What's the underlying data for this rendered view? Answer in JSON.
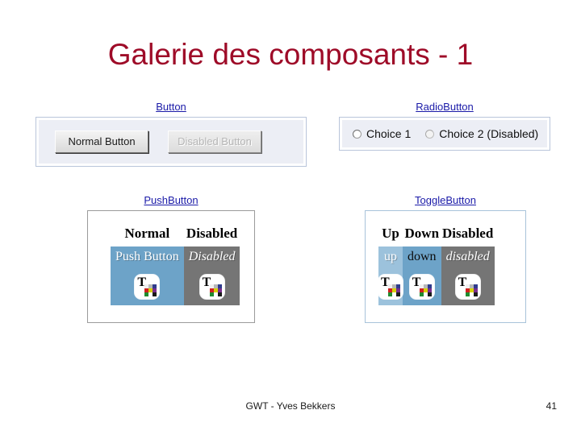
{
  "slide": {
    "title": "Galerie des composants - 1",
    "title_color": "#9e0b28"
  },
  "groups": {
    "button": {
      "title": "Button",
      "normal_label": "Normal Button",
      "disabled_label": "Disabled Button"
    },
    "radio": {
      "title": "RadioButton",
      "choice1_label": "Choice 1",
      "choice2_label": "Choice 2 (Disabled)"
    },
    "push": {
      "title": "PushButton",
      "header_normal": "Normal",
      "header_disabled": "Disabled",
      "normal_label": "Push Button",
      "disabled_label": "Disabled",
      "icon_name": "text-palette-icon"
    },
    "toggle": {
      "title": "ToggleButton",
      "header_up": "Up",
      "header_down": "Down",
      "header_disabled": "Disabled",
      "up_label": "up",
      "down_label": "down",
      "disabled_label": "disabled",
      "icon_name": "text-palette-icon"
    }
  },
  "colors": {
    "panel_border_blue": "#b9c5da",
    "panel_inner": "#eceef5",
    "cell_blue": "#6da3c8",
    "cell_blue_light": "#9cc2dc",
    "cell_grey": "#757575",
    "link_blue": "#1a1aa8"
  },
  "footer": {
    "text": "GWT - Yves Bekkers",
    "page": "41"
  }
}
